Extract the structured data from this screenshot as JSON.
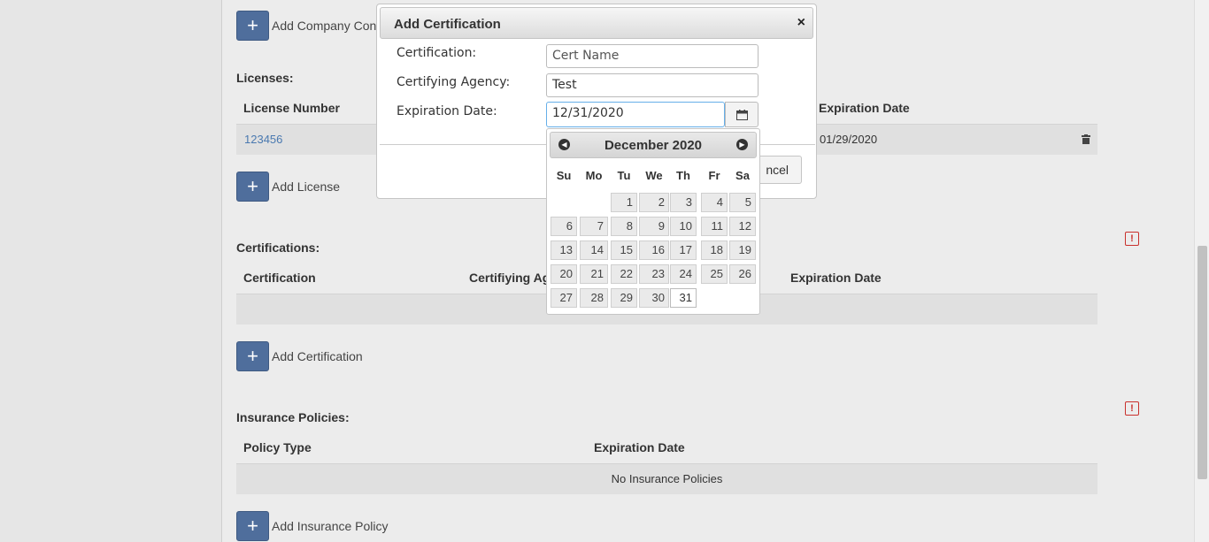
{
  "page": {
    "add_company_contact": "Add Company Conta",
    "licenses": {
      "title": "Licenses:",
      "headers": {
        "number": "License Number",
        "expiration": "Expiration Date"
      },
      "row": {
        "number": "123456",
        "expiration": "01/29/2020"
      },
      "add_label": "Add License"
    },
    "certifications": {
      "title": "Certifications:",
      "headers": {
        "certification": "Certification",
        "agency": "Certifiying Age",
        "expiration": "Expiration Date"
      },
      "add_label": "Add Certification"
    },
    "insurance": {
      "title": "Insurance Policies:",
      "headers": {
        "type": "Policy Type",
        "expiration": "Expiration Date"
      },
      "empty": "No Insurance Policies",
      "add_label": "Add Insurance Policy"
    },
    "add_icon": "+",
    "alert_icon": "!"
  },
  "dialog": {
    "title": "Add Certification",
    "close_icon": "×",
    "fields": {
      "certification_label": "Certification:",
      "certification_value": "Cert Name",
      "agency_label": "Certifying Agency:",
      "agency_value": "Test",
      "expiration_label": "Expiration Date:",
      "expiration_value": "12/31/2020"
    },
    "cancel_label": "ncel"
  },
  "datepicker": {
    "month_year": "December 2020",
    "prev_icon": "◀",
    "next_icon": "▶",
    "weekdays": [
      "Su",
      "Mo",
      "Tu",
      "We",
      "Th",
      "Fr",
      "Sa"
    ],
    "days": [
      "1",
      "2",
      "3",
      "4",
      "5",
      "6",
      "7",
      "8",
      "9",
      "10",
      "11",
      "12",
      "13",
      "14",
      "15",
      "16",
      "17",
      "18",
      "19",
      "20",
      "21",
      "22",
      "23",
      "24",
      "25",
      "26",
      "27",
      "28",
      "29",
      "30",
      "31"
    ],
    "selected_day": "31"
  },
  "colors": {
    "accent": "#4f6e9c",
    "alert": "#c9302c"
  }
}
